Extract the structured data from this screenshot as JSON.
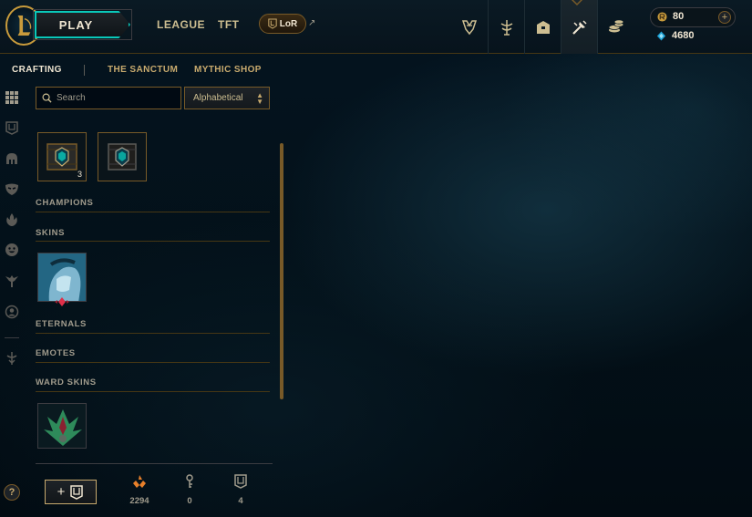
{
  "topbar": {
    "play_label": "PLAY",
    "nav": [
      "LEAGUE",
      "TFT"
    ],
    "lor_label": "LoR",
    "external_glyph": "↗",
    "nav_icons": [
      "trophy-icon",
      "clash-icon",
      "collection-icon",
      "crafting-icon",
      "store-icon"
    ],
    "active_nav_icon": "crafting-icon"
  },
  "wallet": {
    "rp": "80",
    "be": "4680",
    "plus": "+"
  },
  "subnav": {
    "tabs": [
      "CRAFTING",
      "THE SANCTUM",
      "MYTHIC SHOP"
    ],
    "active": "CRAFTING"
  },
  "rail_icons": [
    "grid-icon",
    "chest-icon",
    "helmet-icon",
    "mask-icon",
    "flame-icon",
    "emote-icon",
    "ward-icon",
    "profile-icon",
    "tft-icon"
  ],
  "search": {
    "placeholder": "Search"
  },
  "sort": {
    "value": "Alphabetical"
  },
  "chests": [
    {
      "name": "hextech-chest",
      "count": "3"
    },
    {
      "name": "hextech-chest-2",
      "count": ""
    }
  ],
  "sections": {
    "champions": "CHAMPIONS",
    "skins": "SKINS",
    "eternals": "ETERNALS",
    "emotes": "EMOTES",
    "ward_skins": "WARD SKINS"
  },
  "help": "?",
  "footer": {
    "add_label": "+",
    "resources": [
      {
        "name": "orange-essence",
        "value": "2294",
        "color": "#e8802a"
      },
      {
        "name": "key-fragment",
        "value": "0",
        "color": "#a09b8c"
      },
      {
        "name": "chest-token",
        "value": "4",
        "color": "#a09b8c"
      }
    ]
  },
  "colors": {
    "gold": "#c8aa6e",
    "gold_dark": "#785a28",
    "teal": "#0ac8b9",
    "text": "#a09b8c",
    "text_bright": "#f0e6d2",
    "bg": "#010a13"
  }
}
